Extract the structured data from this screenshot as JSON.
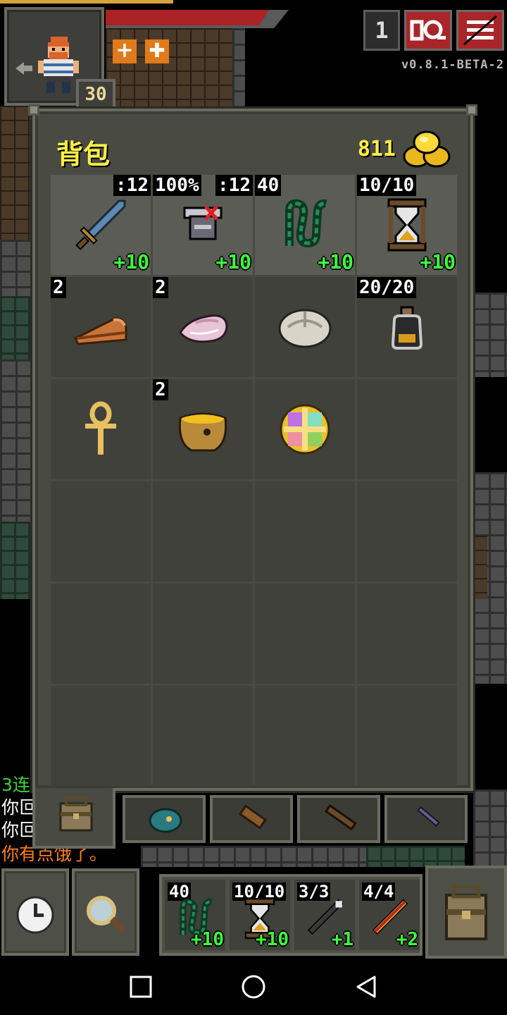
{
  "status": {
    "hero_level": "30",
    "depth": "1",
    "version": "v0.8.1-BETA-2"
  },
  "log": [
    {
      "text": "3连",
      "color": "#3fd13f"
    },
    {
      "text": "你叵",
      "color": "#ffffff"
    },
    {
      "text": "你叵",
      "color": "#ffffff"
    },
    {
      "text": "你有点饿了。",
      "color": "#ff7d1e"
    }
  ],
  "inventory": {
    "title": "背包",
    "gold": "811",
    "slots": [
      {
        "name": "sword",
        "icon": "sword-icon",
        "qty_right": ":12",
        "level": "+10",
        "equipped": true
      },
      {
        "name": "armor",
        "icon": "armor-icon",
        "qty": "100%",
        "qty_right": ":12",
        "level": "+10",
        "equipped": true
      },
      {
        "name": "chains",
        "icon": "chains-icon",
        "qty": "40",
        "level": "+10",
        "equipped": true
      },
      {
        "name": "hourglass",
        "icon": "hourglass-icon",
        "qty": "10/10",
        "level": "+10",
        "equipped": true
      },
      {
        "name": "pasty",
        "icon": "pasty-icon",
        "qty": "2"
      },
      {
        "name": "mystery-meat",
        "icon": "meat-icon",
        "qty": "2"
      },
      {
        "name": "stone",
        "icon": "stone-icon"
      },
      {
        "name": "waterskin",
        "icon": "waterskin-icon",
        "qty": "20/20"
      },
      {
        "name": "ankh",
        "icon": "ankh-icon"
      },
      {
        "name": "honeypot",
        "icon": "honeypot-icon",
        "qty": "2"
      },
      {
        "name": "amulet",
        "icon": "amulet-icon"
      }
    ]
  },
  "quickslots": [
    {
      "icon": "chains-icon",
      "qty": "40",
      "level": "+10"
    },
    {
      "icon": "hourglass-icon",
      "qty": "10/10",
      "level": "+10"
    },
    {
      "icon": "wand-icon",
      "qty": "3/3",
      "level": "+1"
    },
    {
      "icon": "staff-icon",
      "qty": "4/4",
      "level": "+2"
    }
  ]
}
